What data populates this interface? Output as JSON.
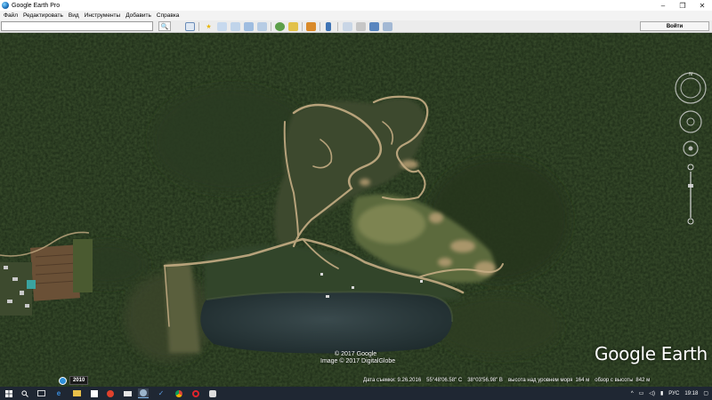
{
  "window": {
    "title": "Google Earth Pro",
    "minimize": "–",
    "maximize": "❐",
    "close": "✕"
  },
  "menu": [
    "Файл",
    "Редактировать",
    "Вид",
    "Инструменты",
    "Добавить",
    "Справка"
  ],
  "toolbar": {
    "search_value": "",
    "search_placeholder": "",
    "search_icon": "🔍",
    "signin_label": "Войти"
  },
  "map": {
    "copyright_line1": "© 2017 Google",
    "copyright_line2": "Image © 2017 DigitalGlobe",
    "brand": "Google Earth",
    "historical_year": "2010"
  },
  "status": {
    "date": "Дата съемки: 9.26.2016",
    "lat": "55°48'06.58\" С",
    "lon": "38°03'56.98\" В",
    "elev_label": "высота над уровнем моря",
    "elev_value": "164 м",
    "eye_label": "обзор с высоты",
    "eye_value": "842 м"
  },
  "taskbar": {
    "lang": "РУС",
    "time": "19:18"
  },
  "colors": {
    "forest": "#1c2a17",
    "clearing": "#7d8451",
    "road": "#c5ad84",
    "lake": "#2a3a3c",
    "taskbar": "#1f2733"
  }
}
